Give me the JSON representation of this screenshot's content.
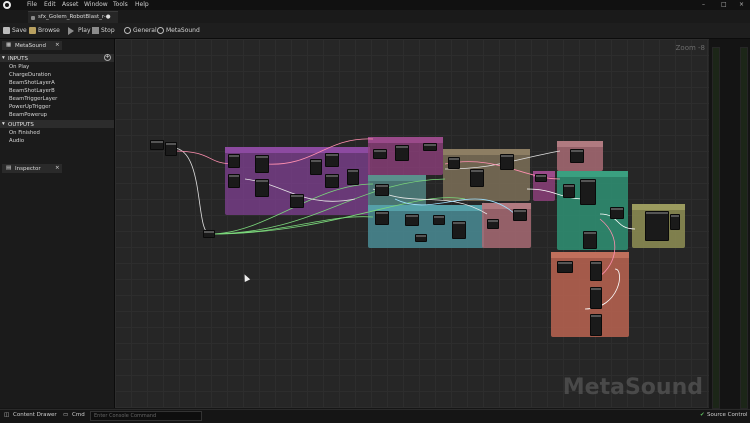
{
  "window": {
    "menu": [
      "File",
      "Edit",
      "Asset",
      "Window",
      "Tools",
      "Help"
    ],
    "controls": [
      "–",
      "□",
      "×"
    ]
  },
  "tab": {
    "label": "sfx_Golem_RobotBlast_r-●"
  },
  "toolbar": {
    "save": "Save",
    "browse": "Browse",
    "play": "Play",
    "stop": "Stop",
    "general": "General",
    "metasound": "MetaSound"
  },
  "left_panel": {
    "metasound_tab": "MetaSound",
    "inputs_header": "INPUTS",
    "inputs": [
      "On Play",
      "ChargeDuration",
      "BeamShotLayerA",
      "BeamShotLayerB",
      "BeamTriggerLayer",
      "PowerUpTrigger",
      "BeamPowerup"
    ],
    "outputs_header": "OUTPUTS",
    "outputs": [
      "On Finished",
      "Audio"
    ],
    "inspector_tab": "Inspector"
  },
  "graph": {
    "zoom": "Zoom -8",
    "watermark": "MetaSound"
  },
  "statusbar": {
    "content_drawer": "Content Drawer",
    "cmd": "Cmd",
    "console_placeholder": "Enter Console Command",
    "source_control": "Source Control"
  },
  "colors": {
    "purple": "#7b3f8c",
    "teal": "#4a8c95",
    "tan": "#7d7058",
    "green": "#2f8c70",
    "salmon": "#b2614f",
    "pink": "#a86b74",
    "olive": "#8a8a52",
    "magenta": "#8c3f7a"
  }
}
